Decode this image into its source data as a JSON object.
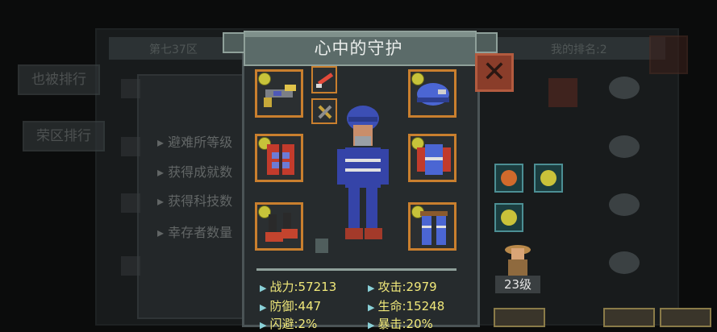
{
  "modal": {
    "title": "心中的守护",
    "close_label": "✕"
  },
  "background": {
    "tabs": [
      "也被排行",
      "荣区排行"
    ],
    "header_left": "第七37区",
    "header_right": "我的排名:2",
    "lines": [
      "避难所等级",
      "获得成就数",
      "获得科技数",
      "幸存者数量"
    ]
  },
  "equipment": {
    "slots": [
      {
        "name": "weapon",
        "icon": "rifle-icon"
      },
      {
        "name": "melee",
        "icon": "laser-sword-icon"
      },
      {
        "name": "helmet",
        "icon": "helmet-icon"
      },
      {
        "name": "vest",
        "icon": "vest-icon"
      },
      {
        "name": "jacket",
        "icon": "jacket-icon"
      },
      {
        "name": "boots",
        "icon": "boots-icon"
      },
      {
        "name": "pants",
        "icon": "pants-icon"
      }
    ]
  },
  "stats": {
    "attack_power_label": "战力:57213",
    "attack_label": "攻击:2979",
    "defense_label": "防御:447",
    "hp_label": "生命:15248",
    "dodge_label": "闪避:2%",
    "crit_label": "暴击:20%"
  },
  "companion": {
    "level_label": "23级"
  },
  "colors": {
    "accent_orange": "#c97f2e",
    "stat_yellow": "#f0e87a",
    "title_gray": "#5b6b69",
    "close_red": "#8a3d2a"
  }
}
